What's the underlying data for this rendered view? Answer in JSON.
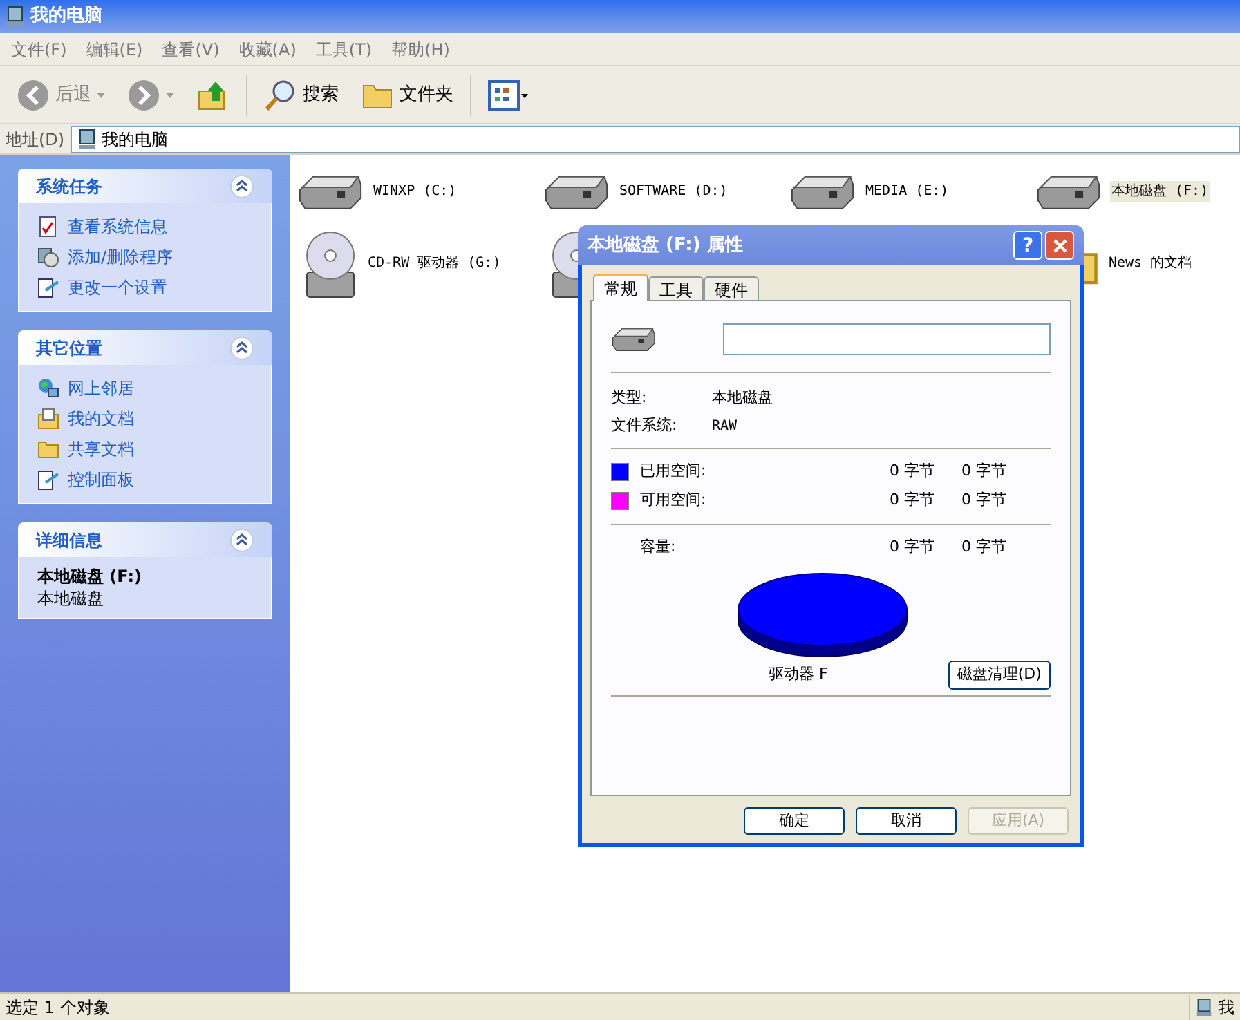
{
  "window": {
    "title": "我的电脑"
  },
  "menu": [
    "文件(F)",
    "编辑(E)",
    "查看(V)",
    "收藏(A)",
    "工具(T)",
    "帮助(H)"
  ],
  "toolbar": [
    {
      "kind": "back",
      "label": "后退",
      "disabled": true
    },
    {
      "kind": "forward",
      "disabled": true
    },
    {
      "kind": "up"
    },
    {
      "kind": "search",
      "label": "搜索"
    },
    {
      "kind": "folders",
      "label": "文件夹"
    },
    {
      "kind": "views"
    }
  ],
  "address": {
    "label": "地址(D)",
    "value": "我的电脑"
  },
  "sidebar": [
    {
      "title": "系统任务",
      "expanded": true,
      "items": [
        {
          "kind": "sysinfo",
          "label": "查看系统信息"
        },
        {
          "kind": "programs",
          "label": "添加/删除程序"
        },
        {
          "kind": "settings",
          "label": "更改一个设置"
        }
      ]
    },
    {
      "title": "其它位置",
      "expanded": true,
      "items": [
        {
          "kind": "network",
          "label": "网上邻居"
        },
        {
          "kind": "documents",
          "label": "我的文档"
        },
        {
          "kind": "folder",
          "label": "共享文档"
        },
        {
          "kind": "settings",
          "label": "控制面板"
        }
      ]
    },
    {
      "title": "详细信息",
      "expanded": true,
      "details": {
        "name": "本地磁盘 (F:)",
        "type": "本地磁盘"
      }
    }
  ],
  "drives": [
    {
      "kind": "hdd",
      "label": "WINXP (C:)",
      "selected": false
    },
    {
      "kind": "hdd",
      "label": "SOFTWARE (D:)",
      "selected": false
    },
    {
      "kind": "hdd",
      "label": "MEDIA (E:)",
      "selected": false
    },
    {
      "kind": "hdd",
      "label": "本地磁盘 (F:)",
      "selected": true
    },
    {
      "kind": "cd",
      "label": "CD-RW 驱动器 (G:)",
      "selected": false
    },
    {
      "kind": "cd"
    },
    {
      "kind": "folder",
      "label": "News 的文档",
      "selected": false
    }
  ],
  "dialog": {
    "title": "本地磁盘 (F:) 属性",
    "help": "?",
    "tabs": [
      {
        "label": "常规",
        "selected": true
      },
      {
        "label": "工具",
        "selected": false
      },
      {
        "label": "硬件",
        "selected": false
      }
    ],
    "type_label": "类型:",
    "type_value": "本地磁盘",
    "fs_label": "文件系统:",
    "fs_value": "RAW",
    "space": [
      {
        "label": "已用空间:",
        "color": "#0000ff",
        "bytes": "0 字节",
        "size": "0 字节"
      },
      {
        "label": "可用空间:",
        "color": "#ff00ff",
        "bytes": "0 字节",
        "size": "0 字节"
      }
    ],
    "capacity": {
      "label": "容量:",
      "bytes": "0 字节",
      "size": "0 字节"
    },
    "drive_label": "驱动器 F",
    "cleanup": "磁盘清理(D)",
    "buttons": [
      {
        "label": "确定",
        "disabled": false
      },
      {
        "label": "取消",
        "disabled": false
      },
      {
        "label": "应用(A)",
        "disabled": true
      }
    ]
  },
  "status_bar": {
    "text": "选定 1 个对象",
    "right": "我"
  }
}
